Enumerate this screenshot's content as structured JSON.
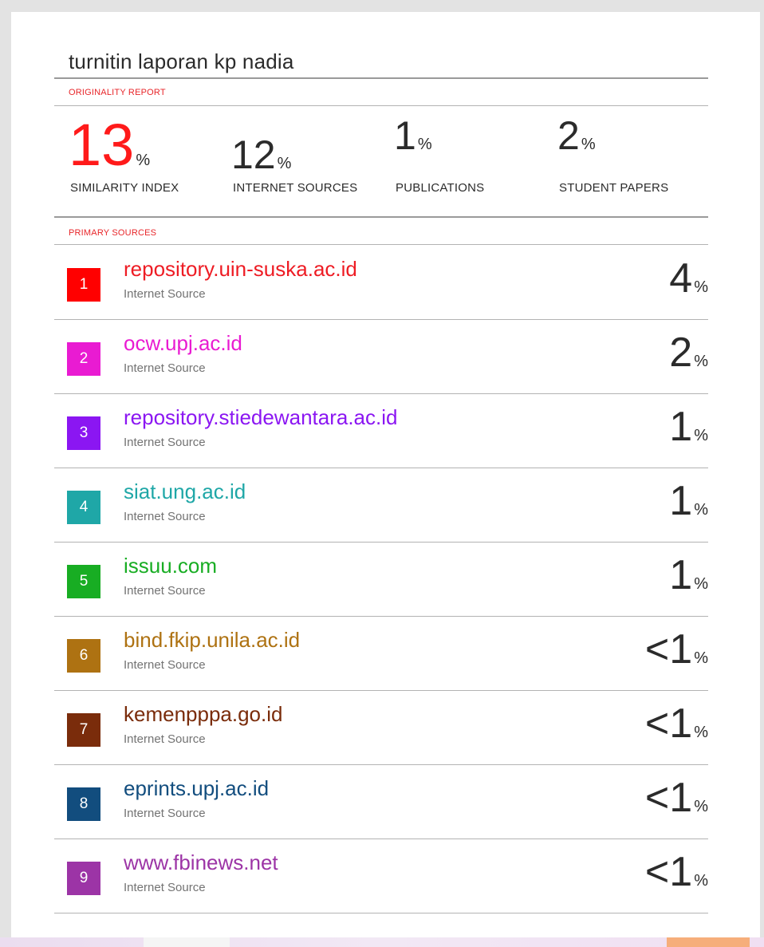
{
  "document": {
    "title": "turnitin laporan kp nadia"
  },
  "originality": {
    "label": "ORIGINALITY REPORT",
    "similarity": {
      "value": "13",
      "unit": "%",
      "label": "SIMILARITY INDEX"
    },
    "internet": {
      "value": "12",
      "unit": "%",
      "label": "INTERNET SOURCES"
    },
    "publications": {
      "value": "1",
      "unit": "%",
      "label": "PUBLICATIONS"
    },
    "student": {
      "value": "2",
      "unit": "%",
      "label": "STUDENT PAPERS"
    }
  },
  "primary_sources": {
    "label": "PRIMARY SOURCES",
    "items": [
      {
        "rank": "1",
        "name": "repository.uin-suska.ac.id",
        "type": "Internet Source",
        "percent": "4",
        "unit": "%",
        "color": "#ff0000",
        "text_color": "#ee1c24"
      },
      {
        "rank": "2",
        "name": "ocw.upj.ac.id",
        "type": "Internet Source",
        "percent": "2",
        "unit": "%",
        "color": "#e91bd2",
        "text_color": "#e91bd2"
      },
      {
        "rank": "3",
        "name": "repository.stiedewantara.ac.id",
        "type": "Internet Source",
        "percent": "1",
        "unit": "%",
        "color": "#8b16f2",
        "text_color": "#8b16f2"
      },
      {
        "rank": "4",
        "name": "siat.ung.ac.id",
        "type": "Internet Source",
        "percent": "1",
        "unit": "%",
        "color": "#1fa7a7",
        "text_color": "#1fa7a7"
      },
      {
        "rank": "5",
        "name": "issuu.com",
        "type": "Internet Source",
        "percent": "1",
        "unit": "%",
        "color": "#18ad23",
        "text_color": "#18ad23"
      },
      {
        "rank": "6",
        "name": "bind.fkip.unila.ac.id",
        "type": "Internet Source",
        "percent": "<1",
        "unit": "%",
        "color": "#ae7212",
        "text_color": "#ae7212"
      },
      {
        "rank": "7",
        "name": "kemenpppa.go.id",
        "type": "Internet Source",
        "percent": "<1",
        "unit": "%",
        "color": "#7a2c0b",
        "text_color": "#7a2c0b"
      },
      {
        "rank": "8",
        "name": "eprints.upj.ac.id",
        "type": "Internet Source",
        "percent": "<1",
        "unit": "%",
        "color": "#124d7e",
        "text_color": "#124d7e"
      },
      {
        "rank": "9",
        "name": "www.fbinews.net",
        "type": "Internet Source",
        "percent": "<1",
        "unit": "%",
        "color": "#9c34a6",
        "text_color": "#9c34a6"
      }
    ]
  }
}
